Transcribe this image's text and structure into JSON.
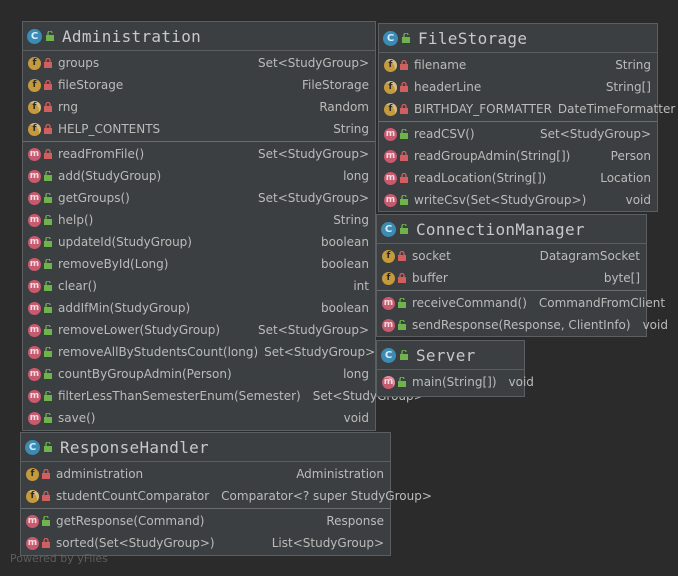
{
  "classes": [
    {
      "key": "administration",
      "badge": "c",
      "title": "Administration",
      "fields": [
        {
          "name": "groups",
          "type": "Set<StudyGroup>",
          "static": false,
          "vis": "private"
        },
        {
          "name": "fileStorage",
          "type": "FileStorage",
          "static": false,
          "vis": "private"
        },
        {
          "name": "rng",
          "type": "Random",
          "static": true,
          "vis": "private"
        },
        {
          "name": "HELP_CONTENTS",
          "type": "String",
          "static": true,
          "vis": "private"
        }
      ],
      "methods": [
        {
          "name": "readFromFile()",
          "type": "Set<StudyGroup>",
          "vis": "private"
        },
        {
          "name": "add(StudyGroup)",
          "type": "long",
          "vis": "public"
        },
        {
          "name": "getGroups()",
          "type": "Set<StudyGroup>",
          "vis": "public"
        },
        {
          "name": "help()",
          "type": "String",
          "vis": "public"
        },
        {
          "name": "updateId(StudyGroup)",
          "type": "boolean",
          "vis": "public"
        },
        {
          "name": "removeById(Long)",
          "type": "boolean",
          "vis": "public"
        },
        {
          "name": "clear()",
          "type": "int",
          "vis": "public"
        },
        {
          "name": "addIfMin(StudyGroup)",
          "type": "boolean",
          "vis": "public"
        },
        {
          "name": "removeLower(StudyGroup)",
          "type": "Set<StudyGroup>",
          "vis": "public"
        },
        {
          "name": "removeAllByStudentsCount(long)",
          "type": "Set<StudyGroup>",
          "vis": "public"
        },
        {
          "name": "countByGroupAdmin(Person)",
          "type": "long",
          "vis": "public"
        },
        {
          "name": "filterLessThanSemesterEnum(Semester)",
          "type": "Set<StudyGroup>",
          "vis": "public",
          "tight": true
        },
        {
          "name": "save()",
          "type": "void",
          "vis": "public"
        }
      ]
    },
    {
      "key": "filestorage",
      "badge": "c",
      "title": "FileStorage",
      "fields": [
        {
          "name": "filename",
          "type": "String",
          "static": true,
          "vis": "private"
        },
        {
          "name": "headerLine",
          "type": "String[]",
          "static": true,
          "vis": "private"
        },
        {
          "name": "BIRTHDAY_FORMATTER",
          "type": "DateTimeFormatter",
          "static": true,
          "vis": "private"
        }
      ],
      "methods": [
        {
          "name": "readCSV()",
          "type": "Set<StudyGroup>",
          "vis": "public"
        },
        {
          "name": "readGroupAdmin(String[])",
          "type": "Person",
          "vis": "private"
        },
        {
          "name": "readLocation(String[])",
          "type": "Location",
          "vis": "private"
        },
        {
          "name": "writeCsv(Set<StudyGroup>)",
          "type": "void",
          "vis": "public"
        }
      ]
    },
    {
      "key": "connectionmanager",
      "badge": "c",
      "title": "ConnectionManager",
      "fields": [
        {
          "name": "socket",
          "type": "DatagramSocket",
          "static": false,
          "vis": "private"
        },
        {
          "name": "buffer",
          "type": "byte[]",
          "static": false,
          "vis": "private"
        }
      ],
      "methods": [
        {
          "name": "receiveCommand()",
          "type": "CommandFromClient",
          "vis": "public",
          "tight": true
        },
        {
          "name": "sendResponse(Response, ClientInfo)",
          "type": "void",
          "vis": "public",
          "tight": true
        }
      ]
    },
    {
      "key": "server",
      "badge": "c",
      "title": "Server",
      "fields": [],
      "methods": [
        {
          "name": "main(String[])",
          "type": "void",
          "vis": "public",
          "static": true,
          "tight": true
        }
      ]
    },
    {
      "key": "responsehandler",
      "badge": "c",
      "title": "ResponseHandler",
      "fields": [
        {
          "name": "administration",
          "type": "Administration",
          "static": false,
          "vis": "private"
        },
        {
          "name": "studentCountComparator",
          "type": "Comparator<? super StudyGroup>",
          "static": true,
          "vis": "private",
          "tight": true
        }
      ],
      "methods": [
        {
          "name": "getResponse(Command)",
          "type": "Response",
          "vis": "public"
        },
        {
          "name": "sorted(Set<StudyGroup>)",
          "type": "List<StudyGroup>",
          "vis": "private"
        }
      ]
    }
  ],
  "watermark": "Powered by yFiles",
  "colors": {
    "background": "#2b2b2b",
    "box": "#3c3f41",
    "classBadge": "#3b8bb5",
    "fieldBadge": "#c49a3c",
    "methodBadge": "#c75a6e",
    "private": "#d15f5f",
    "public": "#6fb34d"
  }
}
